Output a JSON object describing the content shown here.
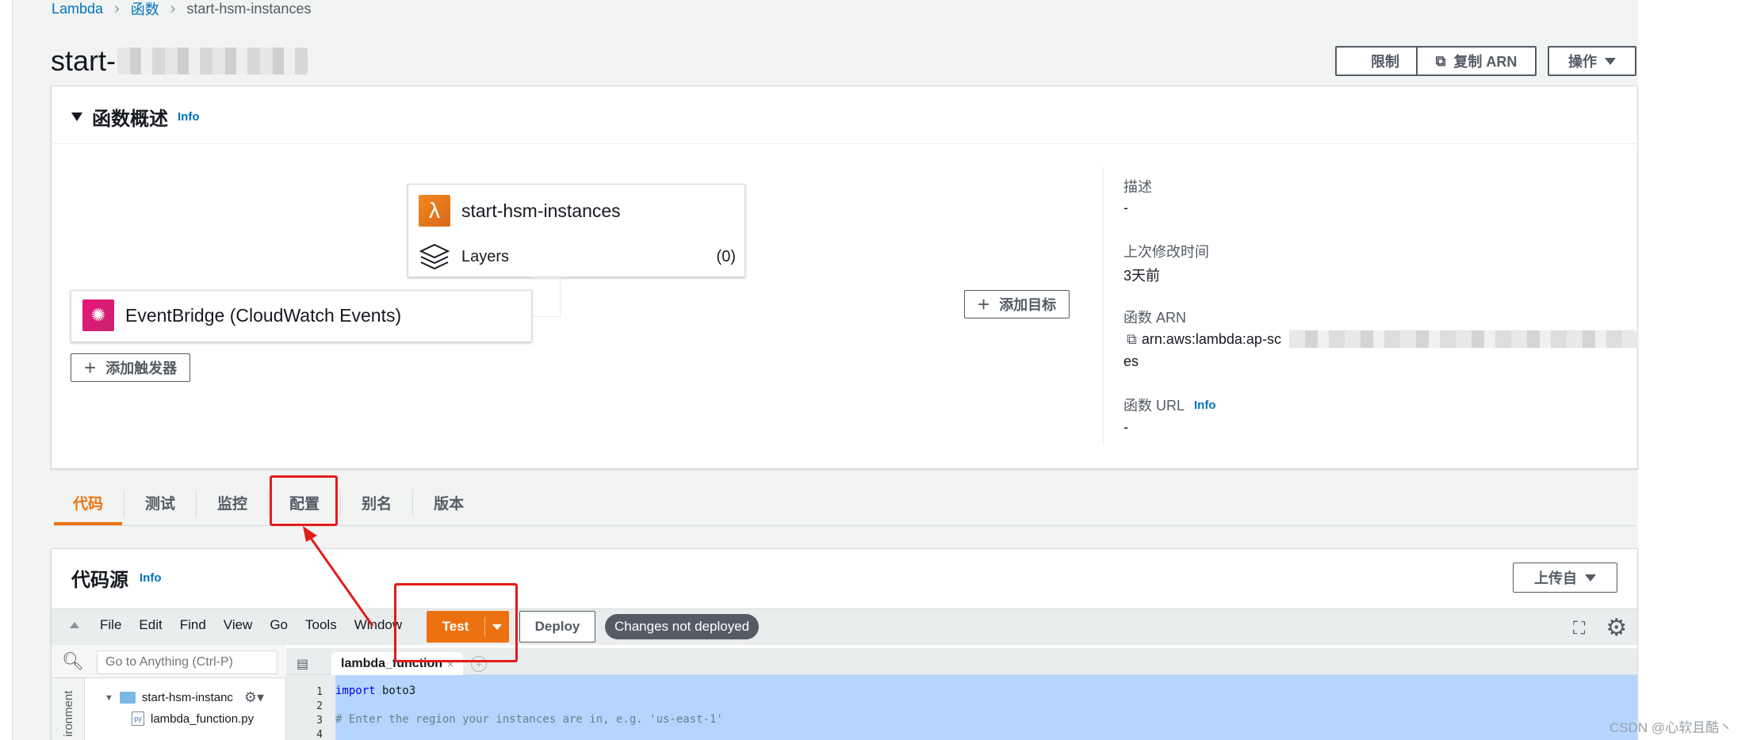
{
  "breadcrumb": {
    "items": [
      "Lambda",
      "函数",
      "start-hsm-instances"
    ]
  },
  "page": {
    "title_prefix": "start-"
  },
  "header_actions": {
    "throttle": "限制",
    "copy_arn": "复制 ARN",
    "actions": "操作"
  },
  "overview": {
    "heading": "函数概述",
    "info": "Info",
    "function_name": "start-hsm-instances",
    "layers_label": "Layers",
    "layers_count": "(0)",
    "trigger_name": "EventBridge (CloudWatch Events)",
    "add_trigger": "添加触发器",
    "add_destination": "添加目标",
    "description_label": "描述",
    "description_value": "-",
    "last_modified_label": "上次修改时间",
    "last_modified_value": "3天前",
    "arn_label": "函数 ARN",
    "arn_prefix": "arn:aws:lambda:ap-sc",
    "arn_suffix": "es",
    "url_label": "函数 URL",
    "url_info": "Info",
    "url_value": "-"
  },
  "tabs": [
    "代码",
    "测试",
    "监控",
    "配置",
    "别名",
    "版本"
  ],
  "code_source": {
    "title": "代码源",
    "info": "Info",
    "upload_from": "上传自",
    "menus": [
      "File",
      "Edit",
      "Find",
      "View",
      "Go",
      "Tools",
      "Window"
    ],
    "test": "Test",
    "deploy": "Deploy",
    "status_badge": "Changes not deployed",
    "search_placeholder": "Go to Anything (Ctrl-P)",
    "env_label": "ironment",
    "folder_name": "start-hsm-instanc",
    "file_name": "lambda_function.py",
    "editor_tab": "lambda_function",
    "code_lines": [
      {
        "num": "1",
        "kw": "import",
        "rest": " boto3"
      },
      {
        "num": "2",
        "kw": "",
        "rest": ""
      },
      {
        "num": "3",
        "kw": "",
        "rest": "# Enter the region your instances are in, e.g. 'us-east-1'"
      },
      {
        "num": "4",
        "kw": "",
        "rest": ""
      }
    ]
  },
  "watermark": "CSDN @心软且酷丶",
  "colors": {
    "accent": "#ec7211",
    "link": "#0073bb",
    "highlight": "#e21c1c"
  }
}
